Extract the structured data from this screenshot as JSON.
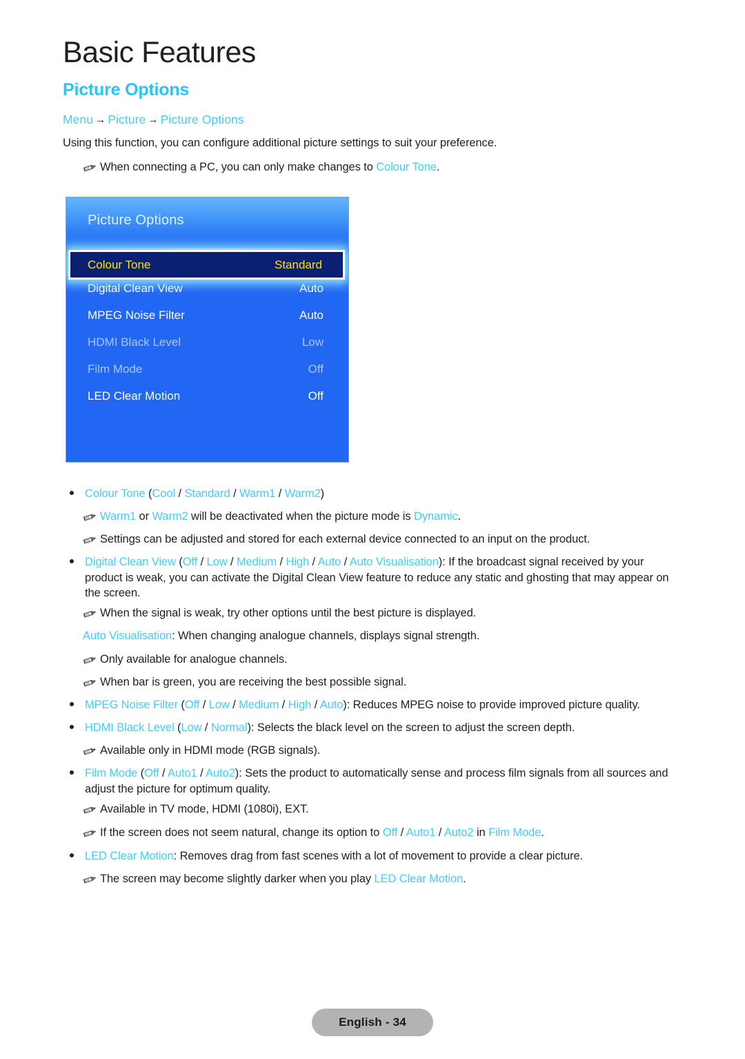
{
  "header": {
    "chapter_title": "Basic Features",
    "section_title": "Picture Options",
    "breadcrumb": {
      "item1": "Menu",
      "arrow1": "→",
      "item2": "Picture",
      "arrow2": "→",
      "item3": "Picture Options"
    },
    "intro": "Using this function, you can configure additional picture settings to suit your preference.",
    "note_pc": {
      "pre": "When connecting a PC, you can only make changes to ",
      "link": "Colour Tone",
      "post": "."
    }
  },
  "osd": {
    "title": "Picture Options",
    "rows": [
      {
        "label": "Colour Tone",
        "value": "Standard",
        "state": "selected"
      },
      {
        "label": "Digital Clean View",
        "value": "Auto",
        "state": "normal"
      },
      {
        "label": "MPEG Noise Filter",
        "value": "Auto",
        "state": "normal"
      },
      {
        "label": "HDMI Black Level",
        "value": "Low",
        "state": "dim"
      },
      {
        "label": "Film Mode",
        "value": "Off",
        "state": "dim"
      },
      {
        "label": "LED Clear Motion",
        "value": "Off",
        "state": "normal"
      }
    ],
    "colors": {
      "background": "#2266f4",
      "selected_bg": "#0b2072",
      "selected_text": "#ffe200",
      "dim_text": "#a9c8fb",
      "text": "#ffffff"
    }
  },
  "body": {
    "colour_tone": {
      "name": "Colour Tone",
      "paren_open": " (",
      "opt1": "Cool",
      "s1": " / ",
      "opt2": "Standard",
      "s2": " / ",
      "opt3": "Warm1",
      "s3": " / ",
      "opt4": "Warm2",
      "paren_close": ")"
    },
    "note_warm": {
      "link1": "Warm1",
      "mid1": " or ",
      "link2": "Warm2",
      "mid2": " will be deactivated when the picture mode is ",
      "link3": "Dynamic",
      "post": "."
    },
    "note_settings": "Settings can be adjusted and stored for each external device connected to an input on the product.",
    "digital_clean_view": {
      "name": "Digital Clean View",
      "paren_open": " (",
      "opt1": "Off",
      "s1": " / ",
      "opt2": "Low",
      "s2": " / ",
      "opt3": "Medium",
      "s3": " / ",
      "opt4": "High",
      "s4": " / ",
      "opt5": "Auto",
      "s5": " / ",
      "opt6": "Auto Visualisation",
      "paren_close": ")",
      "desc": ": If the broadcast signal received by your product is weak, you can activate the Digital Clean View feature to reduce any static and ghosting that may appear on the screen."
    },
    "note_weak_signal": "When the signal is weak, try other options until the best picture is displayed.",
    "auto_visualisation": {
      "link": "Auto Visualisation",
      "desc": ": When changing analogue channels, displays signal strength."
    },
    "note_analogue_only": "Only available for analogue channels.",
    "note_green_bar": "When bar is green, you are receiving the best possible signal.",
    "mpeg_noise_filter": {
      "name": "MPEG Noise Filter",
      "paren_open": " (",
      "opt1": "Off",
      "s1": " / ",
      "opt2": "Low",
      "s2": " / ",
      "opt3": "Medium",
      "s3": " / ",
      "opt4": "High",
      "s4": " / ",
      "opt5": "Auto",
      "paren_close": ")",
      "desc": ": Reduces MPEG noise to provide improved picture quality."
    },
    "hdmi_black_level": {
      "name": "HDMI Black Level",
      "paren_open": " (",
      "opt1": "Low",
      "s1": " / ",
      "opt2": "Normal",
      "paren_close": ")",
      "desc": ": Selects the black level on the screen to adjust the screen depth."
    },
    "note_hdmi_rgb": "Available only in HDMI mode (RGB signals).",
    "film_mode": {
      "name": "Film Mode",
      "paren_open": " (",
      "opt1": "Off",
      "s1": " / ",
      "opt2": "Auto1",
      "s2": " / ",
      "opt3": "Auto2",
      "paren_close": ")",
      "desc": ": Sets the product to automatically sense and process film signals from all sources and adjust the picture for optimum quality."
    },
    "note_tv_mode": "Available in TV mode, HDMI (1080i), EXT.",
    "note_not_natural": {
      "pre": "If the screen does not seem natural, change its option to ",
      "opt1": "Off",
      "s1": " / ",
      "opt2": "Auto1",
      "s2": " / ",
      "opt3": "Auto2",
      "mid": " in ",
      "link": "Film Mode",
      "post": "."
    },
    "led_clear_motion": {
      "name": "LED Clear Motion",
      "desc": ": Removes drag from fast scenes with a lot of movement to provide a clear picture."
    },
    "note_darker": {
      "pre": "The screen may become slightly darker when you play ",
      "link": "LED Clear Motion",
      "post": "."
    }
  },
  "footer": {
    "page_label": "English - 34"
  }
}
